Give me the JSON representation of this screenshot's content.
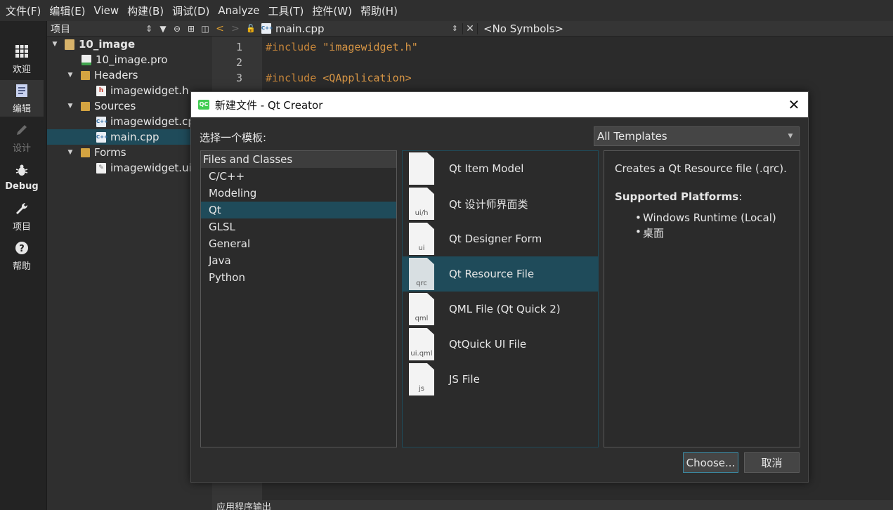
{
  "menubar": {
    "items": [
      "文件(F)",
      "编辑(E)",
      "View",
      "构建(B)",
      "调试(D)",
      "Analyze",
      "工具(T)",
      "控件(W)",
      "帮助(H)"
    ]
  },
  "modebar": {
    "items": [
      {
        "label": "欢迎",
        "icon": "grid-icon"
      },
      {
        "label": "编辑",
        "icon": "edit-document-icon"
      },
      {
        "label": "设计",
        "icon": "pencil-icon"
      },
      {
        "label": "Debug",
        "icon": "bug-icon"
      },
      {
        "label": "项目",
        "icon": "wrench-icon"
      },
      {
        "label": "帮助",
        "icon": "help-icon"
      }
    ]
  },
  "project_panel": {
    "title": "项目",
    "tree": [
      {
        "label": "10_image",
        "icon": "project-icon"
      },
      {
        "label": "10_image.pro",
        "icon": "pro-file-icon"
      },
      {
        "label": "Headers",
        "icon": "folder-icon"
      },
      {
        "label": "imagewidget.h",
        "icon": "header-file-icon"
      },
      {
        "label": "Sources",
        "icon": "folder-icon"
      },
      {
        "label": "imagewidget.cpp",
        "icon": "cpp-file-icon"
      },
      {
        "label": "main.cpp",
        "icon": "cpp-file-icon"
      },
      {
        "label": "Forms",
        "icon": "folder-icon"
      },
      {
        "label": "imagewidget.ui",
        "icon": "ui-file-icon"
      }
    ]
  },
  "editor": {
    "file_name": "main.cpp",
    "symbols": "<No Symbols>",
    "line_numbers": [
      "1",
      "2",
      "3"
    ],
    "lines": [
      {
        "kw": "#include ",
        "str": "\"imagewidget.h\""
      },
      {
        "kw": "",
        "str": ""
      },
      {
        "kw": "#include ",
        "str": "<QApplication>"
      }
    ]
  },
  "output_bar": {
    "label": "应用程序输出"
  },
  "dialog": {
    "title": "新建文件 - Qt Creator",
    "template_label": "选择一个模板:",
    "filter_value": "All Templates",
    "category_header": "Files and Classes",
    "categories": [
      "C/C++",
      "Modeling",
      "Qt",
      "GLSL",
      "General",
      "Java",
      "Python"
    ],
    "selected_category": "Qt",
    "templates": [
      {
        "label": "Qt Item Model",
        "ext": ""
      },
      {
        "label": "Qt 设计师界面类",
        "ext": "ui/h"
      },
      {
        "label": "Qt Designer Form",
        "ext": "ui"
      },
      {
        "label": "Qt Resource File",
        "ext": "qrc"
      },
      {
        "label": "QML File (Qt Quick 2)",
        "ext": "qml"
      },
      {
        "label": "QtQuick UI File",
        "ext": "ui.qml"
      },
      {
        "label": "JS File",
        "ext": "js"
      }
    ],
    "selected_template": "Qt Resource File",
    "description": "Creates a Qt Resource file (.qrc).",
    "platforms_heading": "Supported Platforms",
    "platforms_colon": ":",
    "platforms": [
      "Windows Runtime (Local)",
      "桌面"
    ],
    "choose_button": "Choose...",
    "cancel_button": "取消"
  }
}
